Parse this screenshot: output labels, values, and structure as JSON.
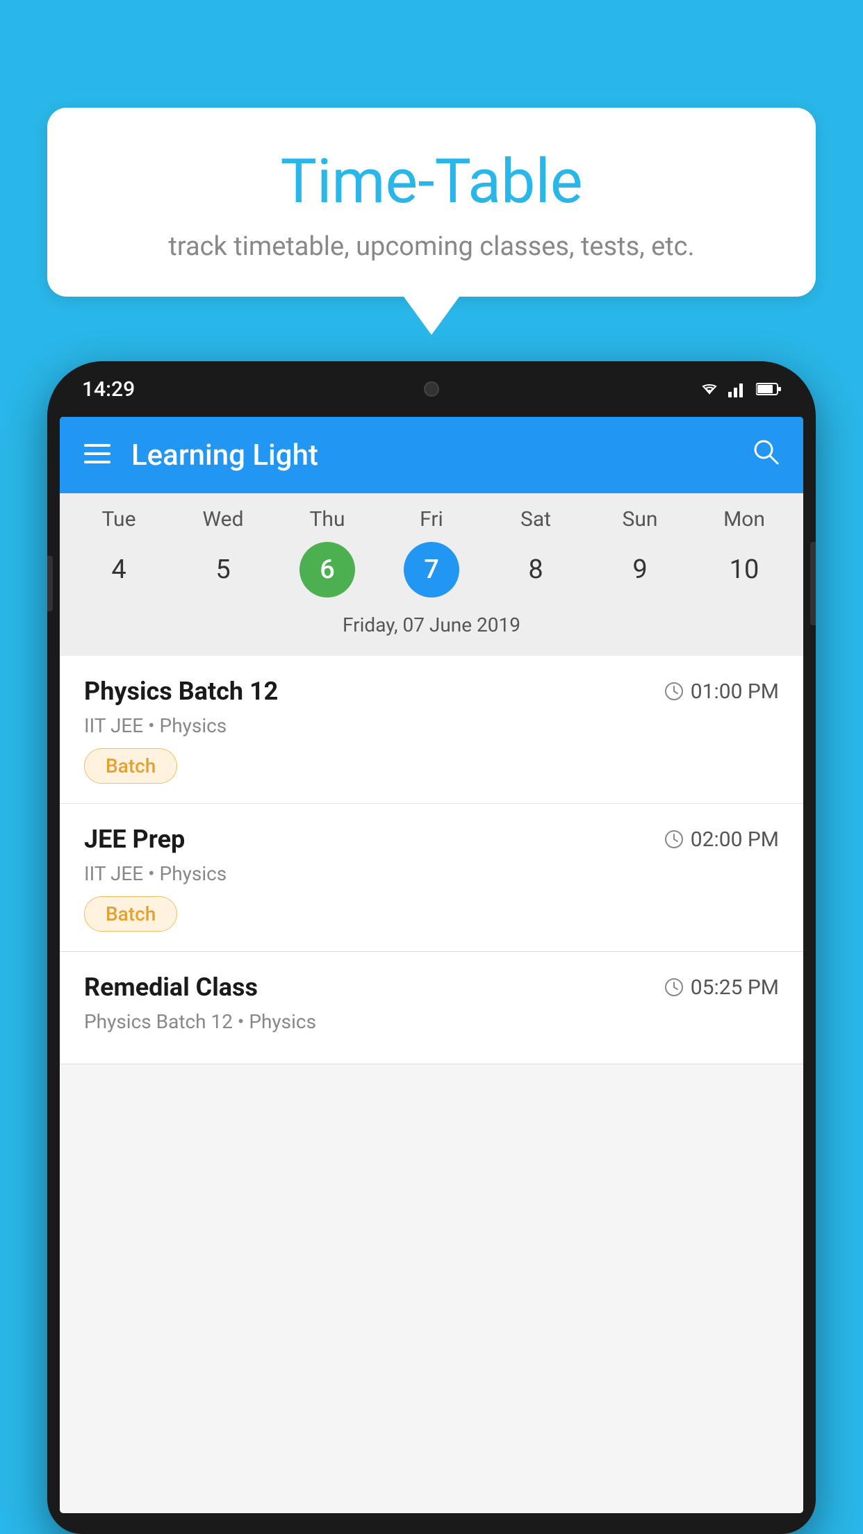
{
  "bubble": {
    "title": "Time-Table",
    "subtitle": "track timetable, upcoming classes, tests, etc."
  },
  "statusBar": {
    "time": "14:29"
  },
  "appBar": {
    "title": "Learning Light"
  },
  "calendar": {
    "days": [
      {
        "abbr": "Tue",
        "num": "4"
      },
      {
        "abbr": "Wed",
        "num": "5"
      },
      {
        "abbr": "Thu",
        "num": "6",
        "state": "today"
      },
      {
        "abbr": "Fri",
        "num": "7",
        "state": "selected"
      },
      {
        "abbr": "Sat",
        "num": "8"
      },
      {
        "abbr": "Sun",
        "num": "9"
      },
      {
        "abbr": "Mon",
        "num": "10"
      }
    ],
    "selectedLabel": "Friday, 07 June 2019"
  },
  "schedule": [
    {
      "title": "Physics Batch 12",
      "time": "01:00 PM",
      "subtitle": "IIT JEE • Physics",
      "badge": "Batch"
    },
    {
      "title": "JEE Prep",
      "time": "02:00 PM",
      "subtitle": "IIT JEE • Physics",
      "badge": "Batch"
    },
    {
      "title": "Remedial Class",
      "time": "05:25 PM",
      "subtitle": "Physics Batch 12 • Physics",
      "badge": ""
    }
  ],
  "icons": {
    "hamburger": "≡",
    "search": "🔍",
    "clock": "🕐"
  }
}
